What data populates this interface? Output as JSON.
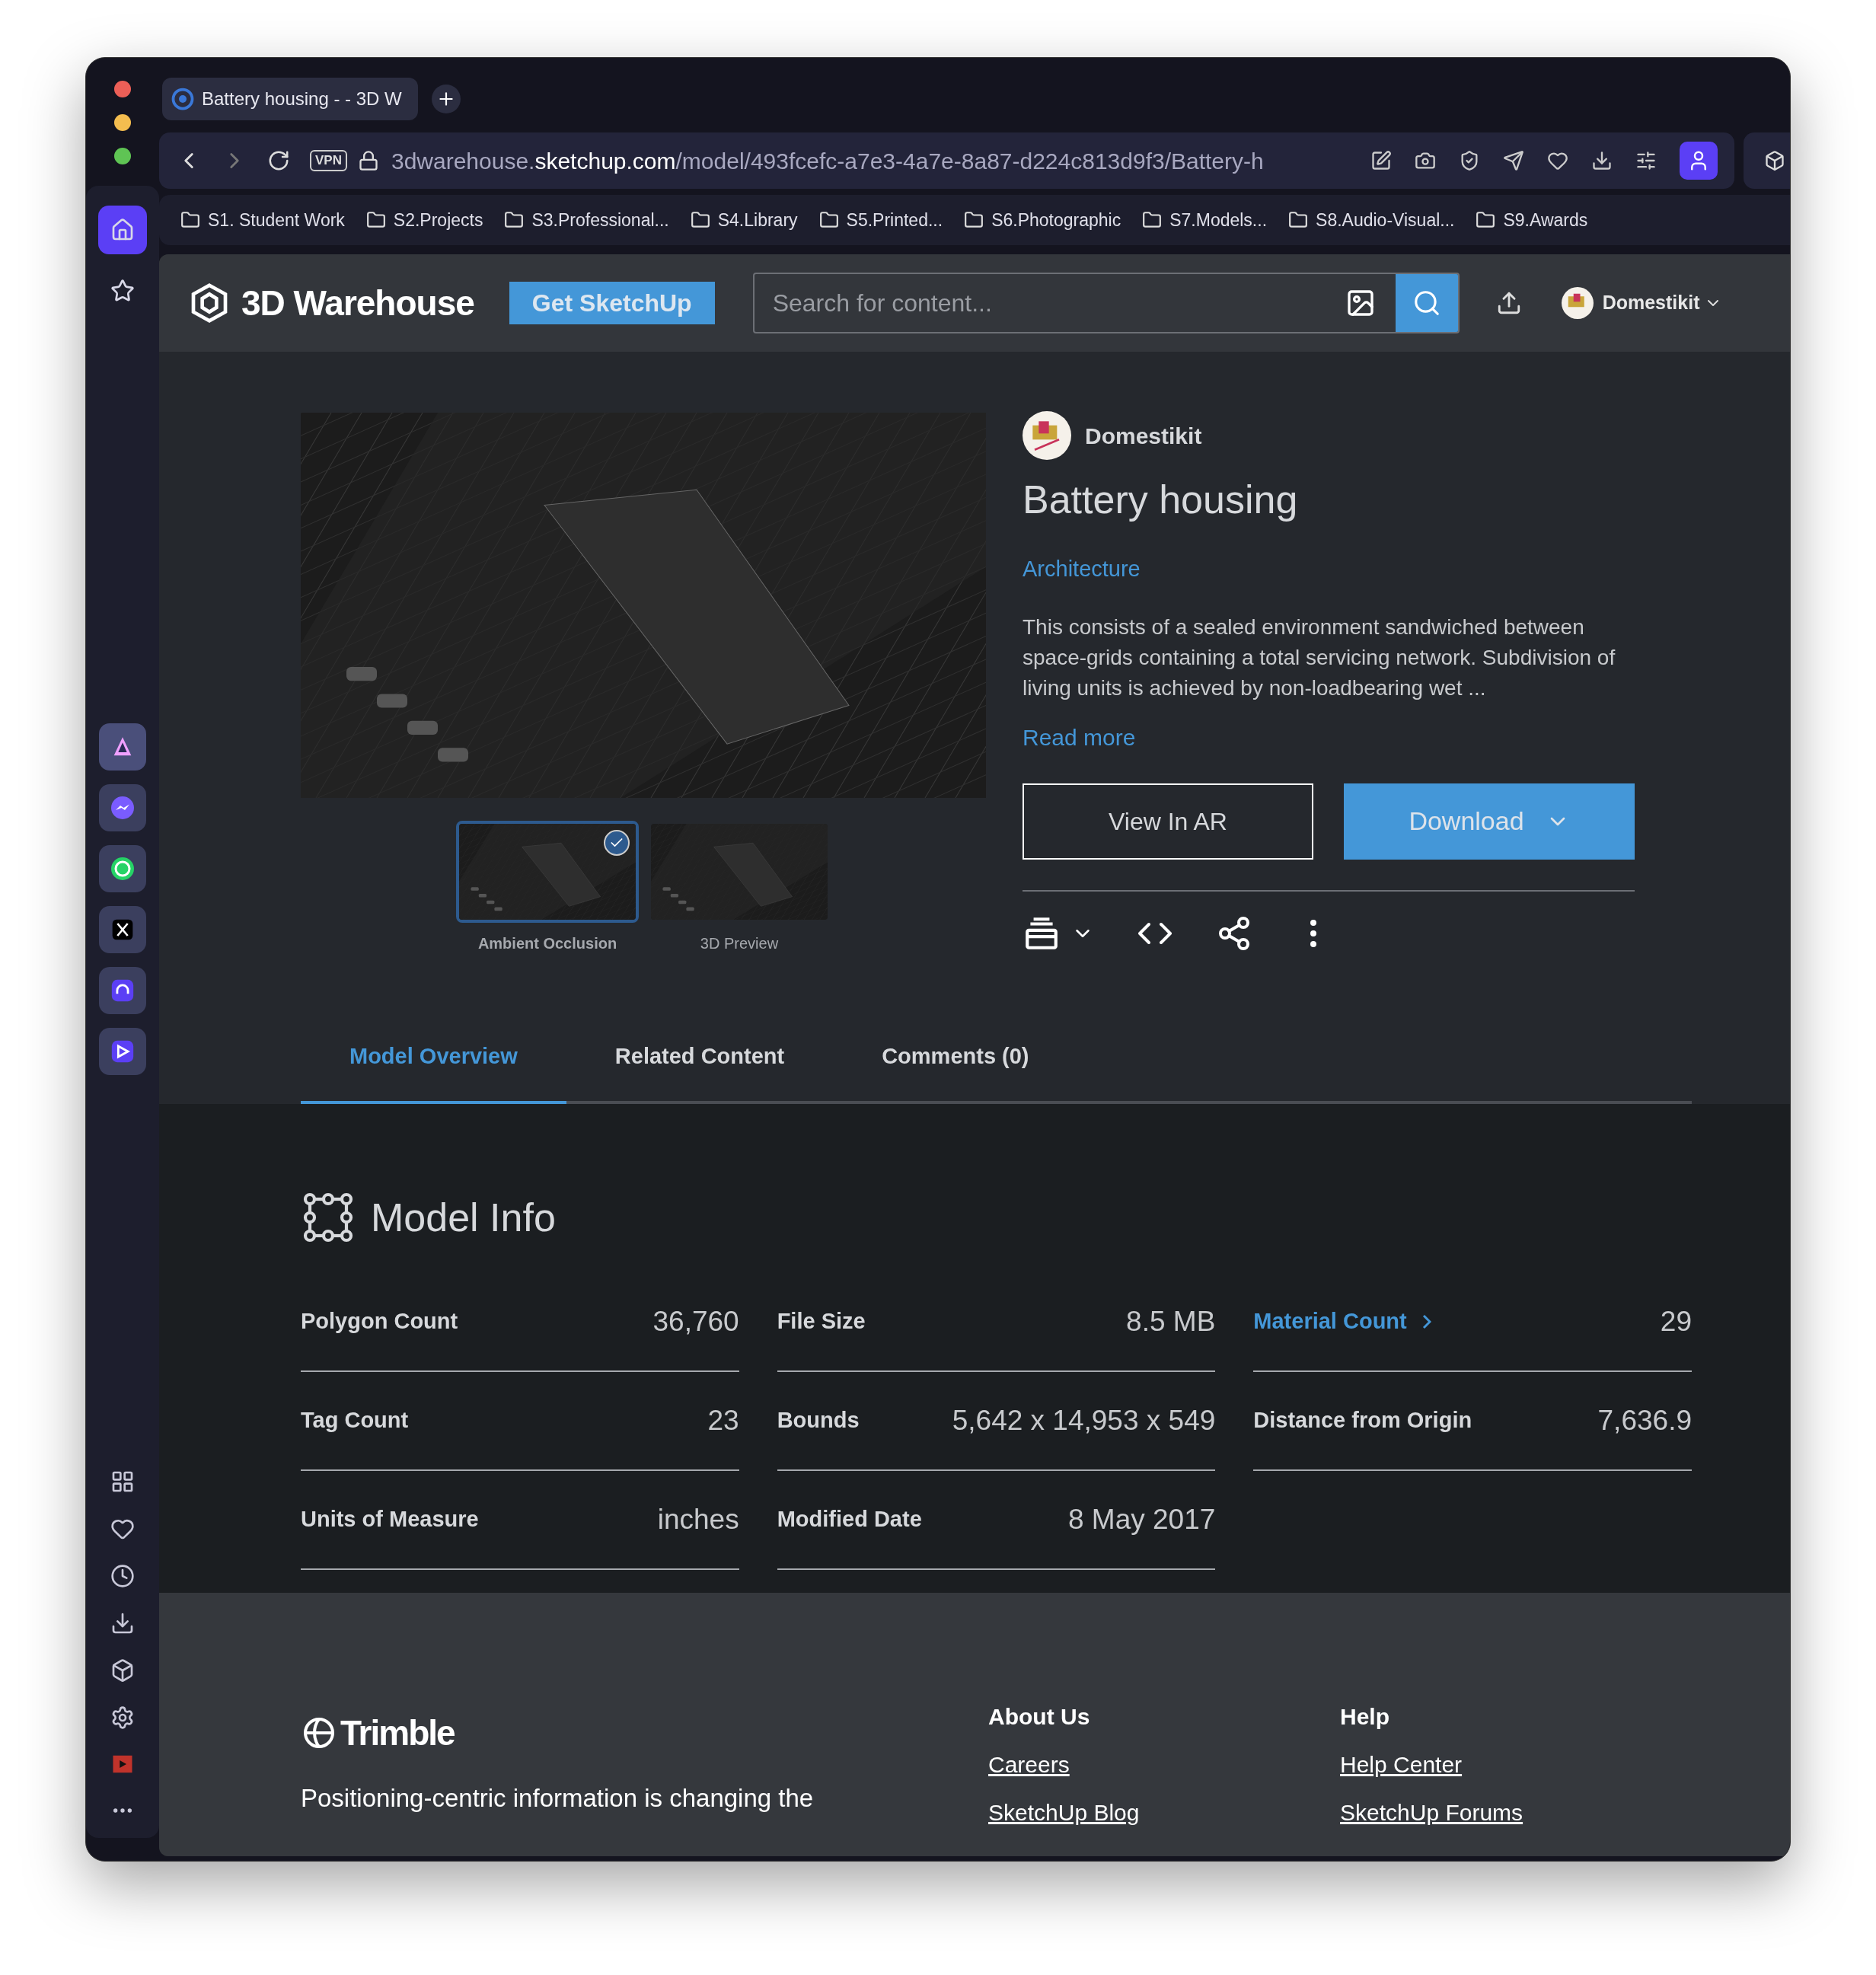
{
  "browser": {
    "tab_title": "Battery housing - - 3D W",
    "url_prefix": "3dwarehouse.",
    "url_domain": "sketchup.com",
    "url_path": "/model/493fcefc-a7e3-4a7e-8a87-d224c813d9f3/Battery-h",
    "vpn": "VPN",
    "bookmarks": [
      "S1. Student Work",
      "S2.Projects",
      "S3.Professional...",
      "S4.Library",
      "S5.Printed...",
      "S6.Photographic",
      "S7.Models...",
      "S8.Audio-Visual...",
      "S9.Awards"
    ]
  },
  "sidebar": {
    "items": [
      {
        "kind": "home",
        "selected": true
      },
      {
        "kind": "star",
        "selected": false
      }
    ]
  },
  "header": {
    "logo": "3D Warehouse",
    "cta": "Get SketchUp",
    "search_placeholder": "Search for content...",
    "user": "Domestikit"
  },
  "model": {
    "author": "Domestikit",
    "title": "Battery housing",
    "category": "Architecture",
    "description": "This consists of a sealed environment sandwiched between space-grids containing a total servicing network. Subdivision of living units is achieved by non-loadbearing wet ...",
    "read_more": "Read more",
    "view_ar": "View In AR",
    "download": "Download",
    "thumbnails": [
      {
        "label": "Ambient Occlusion",
        "selected": true
      },
      {
        "label": "3D Preview",
        "selected": false
      }
    ]
  },
  "tabs": [
    {
      "label": "Model Overview",
      "selected": true
    },
    {
      "label": "Related Content",
      "selected": false
    },
    {
      "label": "Comments (0)",
      "selected": false
    }
  ],
  "model_info": {
    "title": "Model Info",
    "rows": [
      {
        "label": "Polygon Count",
        "value": "36,760",
        "kind": "plain"
      },
      {
        "label": "File Size",
        "value": "8.5 MB",
        "kind": "plain"
      },
      {
        "label": "Material Count",
        "value": "29",
        "kind": "link"
      },
      {
        "label": "Tag Count",
        "value": "23",
        "kind": "plain"
      },
      {
        "label": "Bounds",
        "value": "5,642 x 14,953 x 549",
        "kind": "plain"
      },
      {
        "label": "Distance from Origin",
        "value": "7,636.9",
        "kind": "plain"
      },
      {
        "label": "Units of Measure",
        "value": "inches",
        "kind": "plain"
      },
      {
        "label": "Modified Date",
        "value": "8 May 2017",
        "kind": "plain"
      }
    ]
  },
  "footer": {
    "logo": "Trimble",
    "tagline": "Positioning-centric information is changing the",
    "columns": [
      {
        "title": "About Us",
        "links": [
          "Careers",
          "SketchUp Blog"
        ]
      },
      {
        "title": "Help",
        "links": [
          "Help Center",
          "SketchUp Forums"
        ]
      }
    ]
  }
}
